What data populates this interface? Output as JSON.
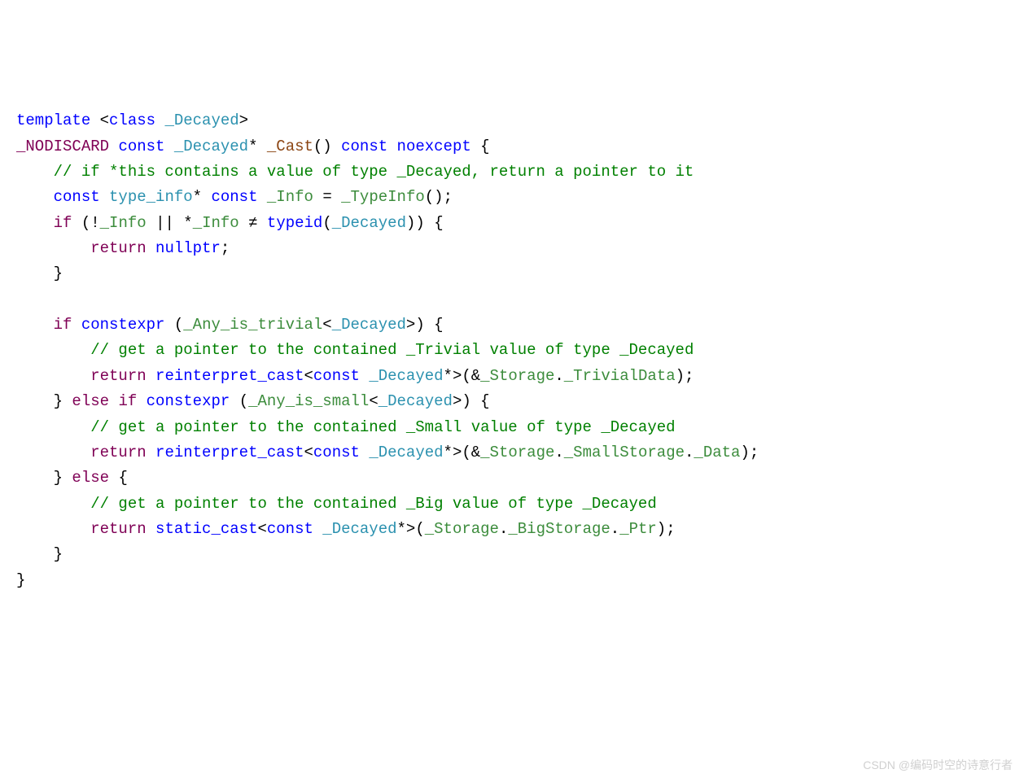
{
  "code": {
    "line1": {
      "template": "template",
      "lt": "<",
      "class": "class",
      "param": "_Decayed",
      "gt": ">"
    },
    "line2": {
      "nodiscard": "_NODISCARD",
      "const1": "const",
      "type": "_Decayed",
      "star": "*",
      "func": "_Cast",
      "parens": "()",
      "const2": "const",
      "noexcept": "noexcept",
      "brace": "{"
    },
    "line3": {
      "indent": "    ",
      "comment": "// if *this contains a value of type _Decayed, return a pointer to it"
    },
    "line4": {
      "indent": "    ",
      "const1": "const",
      "typeinfo": "type_info",
      "star": "*",
      "const2": "const",
      "info": "_Info",
      "eq": "=",
      "typeinfo_fn": "_TypeInfo",
      "parens": "()",
      "semi": ";"
    },
    "line5": {
      "indent": "    ",
      "if": "if",
      "open": "(",
      "not": "!",
      "info1": "_Info",
      "or": "||",
      "star": "*",
      "info2": "_Info",
      "neq": "≠",
      "typeid": "typeid",
      "open2": "(",
      "decayed": "_Decayed",
      "close2": ")",
      "close": ")",
      "brace": "{"
    },
    "line6": {
      "indent": "        ",
      "return": "return",
      "nullptr": "nullptr",
      "semi": ";"
    },
    "line7": {
      "indent": "    ",
      "brace": "}"
    },
    "line9": {
      "indent": "    ",
      "if": "if",
      "constexpr": "constexpr",
      "open": "(",
      "trait": "_Any_is_trivial",
      "lt": "<",
      "decayed": "_Decayed",
      "gt": ">",
      "close": ")",
      "brace": "{"
    },
    "line10": {
      "indent": "        ",
      "comment": "// get a pointer to the contained _Trivial value of type _Decayed"
    },
    "line11": {
      "indent": "        ",
      "return": "return",
      "cast": "reinterpret_cast",
      "lt": "<",
      "const": "const",
      "decayed": "_Decayed",
      "star": "*",
      "gt": ">",
      "open": "(",
      "amp": "&",
      "storage": "_Storage",
      "dot1": ".",
      "trivial": "_TrivialData",
      "close": ")",
      "semi": ";"
    },
    "line12": {
      "indent": "    ",
      "brace1": "}",
      "else": "else",
      "if": "if",
      "constexpr": "constexpr",
      "open": "(",
      "trait": "_Any_is_small",
      "lt": "<",
      "decayed": "_Decayed",
      "gt": ">",
      "close": ")",
      "brace2": "{"
    },
    "line13": {
      "indent": "        ",
      "comment": "// get a pointer to the contained _Small value of type _Decayed"
    },
    "line14": {
      "indent": "        ",
      "return": "return",
      "cast": "reinterpret_cast",
      "lt": "<",
      "const": "const",
      "decayed": "_Decayed",
      "star": "*",
      "gt": ">",
      "open": "(",
      "amp": "&",
      "storage": "_Storage",
      "dot1": ".",
      "small": "_SmallStorage",
      "dot2": ".",
      "data": "_Data",
      "close": ")",
      "semi": ";"
    },
    "line15": {
      "indent": "    ",
      "brace1": "}",
      "else": "else",
      "brace2": "{"
    },
    "line16": {
      "indent": "        ",
      "comment": "// get a pointer to the contained _Big value of type _Decayed"
    },
    "line17": {
      "indent": "        ",
      "return": "return",
      "cast": "static_cast",
      "lt": "<",
      "const": "const",
      "decayed": "_Decayed",
      "star": "*",
      "gt": ">",
      "open": "(",
      "storage": "_Storage",
      "dot1": ".",
      "big": "_BigStorage",
      "dot2": ".",
      "ptr": "_Ptr",
      "close": ")",
      "semi": ";"
    },
    "line18": {
      "indent": "    ",
      "brace": "}"
    },
    "line19": {
      "brace": "}"
    }
  },
  "watermark": "CSDN @编码时空的诗意行者"
}
